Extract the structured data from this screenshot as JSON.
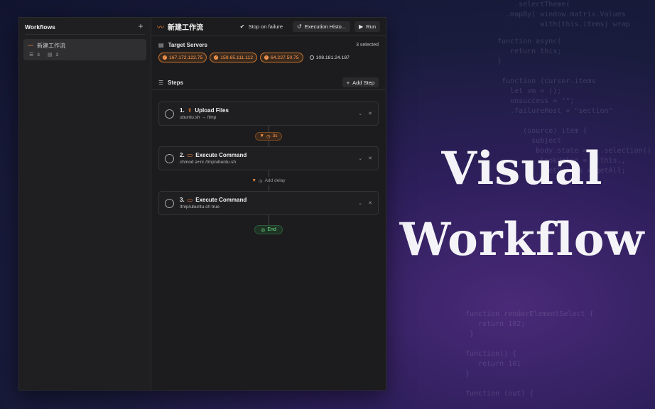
{
  "hero": {
    "line1": "Visual",
    "line2": "Workflow"
  },
  "sidebar": {
    "title": "Workflows",
    "add_icon": "plus-icon",
    "items": [
      {
        "name": "新建工作流",
        "steps_count": "3",
        "servers_count": "3"
      }
    ]
  },
  "topbar": {
    "title": "新建工作流",
    "stop_on_failure": "Stop on failure",
    "execution_history": "Execution Histo...",
    "run": "Run"
  },
  "servers": {
    "title": "Target Servers",
    "selected": "3 selected",
    "items": [
      {
        "ip": "167.172.122.75",
        "selected": true
      },
      {
        "ip": "159.65.111.112",
        "selected": true
      },
      {
        "ip": "64.227.50.75",
        "selected": true
      },
      {
        "ip": "108.181.24.187",
        "selected": false
      }
    ]
  },
  "steps": {
    "title": "Steps",
    "add_step": "Add Step",
    "items": [
      {
        "num": "1.",
        "title": "Upload Files",
        "sub": "ubuntu.sh → /tmp"
      },
      {
        "num": "2.",
        "title": "Execute Command",
        "sub": "chmod a+rx  /tmp/ubuntu.sh"
      },
      {
        "num": "3.",
        "title": "Execute Command",
        "sub": "/tmp/ubuntu.sh  true"
      }
    ],
    "delay_1": "3s",
    "add_delay": "Add delay",
    "end": "End"
  },
  "colors": {
    "accent": "#ff8a3d",
    "success": "#6fe08a"
  }
}
